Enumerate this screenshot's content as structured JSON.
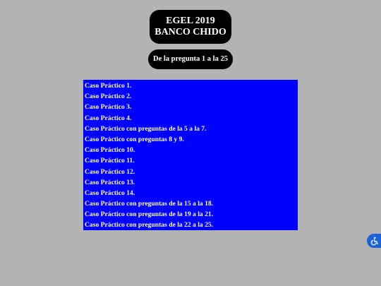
{
  "header": {
    "title_line1": "EGEL 2019",
    "title_line2": "BANCO CHIDO"
  },
  "range_button": {
    "label": "De la pregunta 1 a la 25"
  },
  "cases": [
    "Caso Práctico 1.",
    "Caso Práctico 2.",
    "Caso Práctico 3.",
    "Caso Práctico 4.",
    "Caso Práctico con preguntas de la 5 a la 7.",
    "Caso Práctico con preguntas 8 y 9.",
    "Caso Práctico 10.",
    "Caso Práctico 11.",
    "Caso Práctico 12.",
    "Caso Práctico 13.",
    "Caso Práctico 14.",
    "Caso Práctico con preguntas de la 15 a la 18.",
    "Caso Práctico con preguntas de la 19 a la 21.",
    "Caso Práctico con preguntas de la 22 a la 25."
  ],
  "accessibility_button": {
    "icon": "wheelchair-icon"
  },
  "colors": {
    "page_background": "#b3b3b3",
    "title_background": "#000000",
    "panel_background": "#0000ff",
    "text": "#ffffff",
    "accessibility_accent": "#1c63d8"
  }
}
